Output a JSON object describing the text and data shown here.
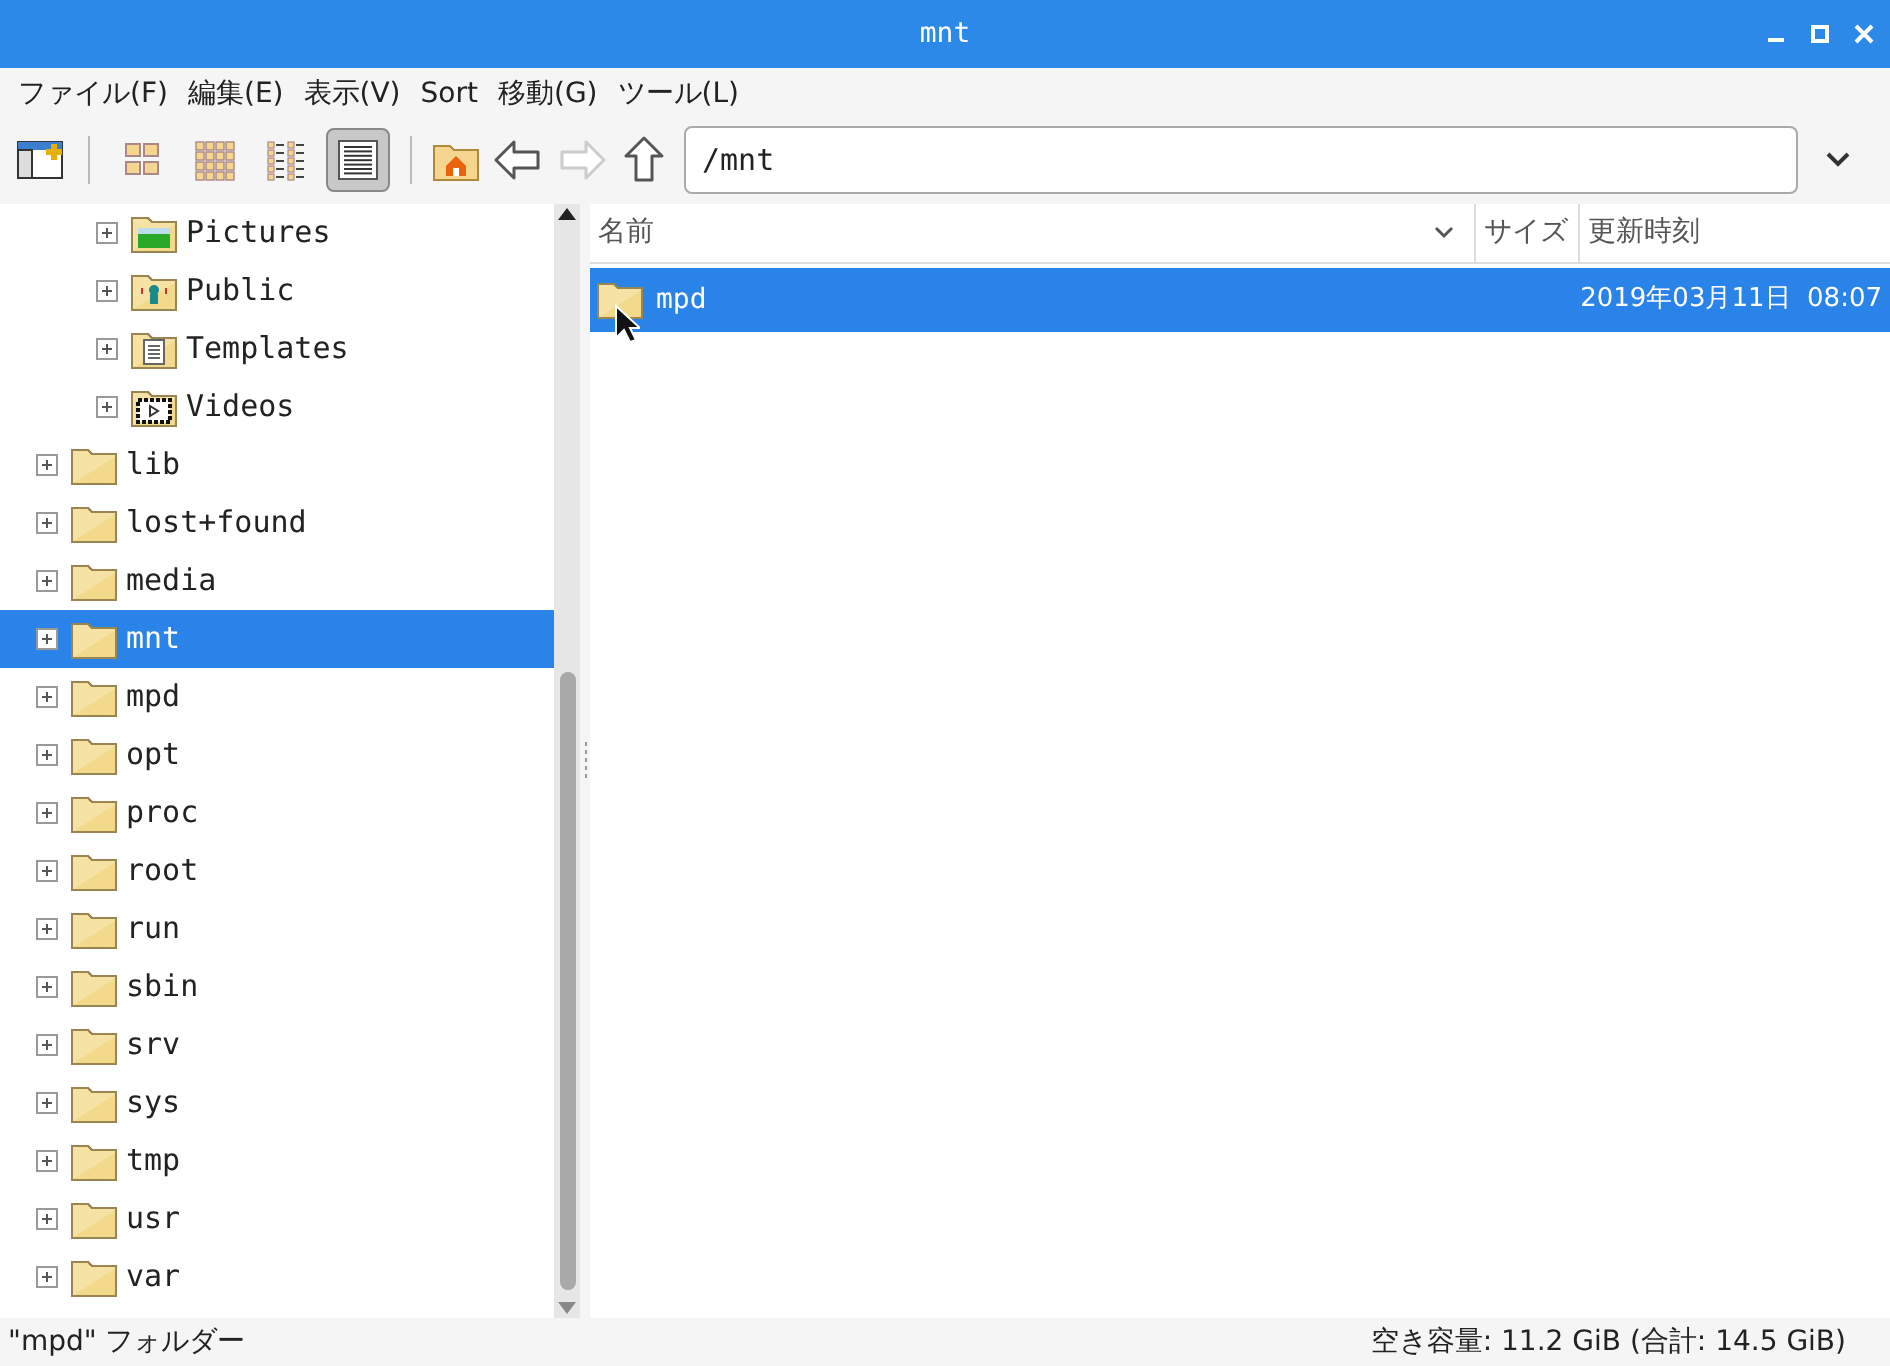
{
  "window": {
    "title": "mnt"
  },
  "menu": [
    "ファイル(F)",
    "編集(E)",
    "表示(V)",
    "Sort",
    "移動(G)",
    "ツール(L)"
  ],
  "toolbar": {
    "view_modes": [
      {
        "kind": "icons",
        "selected": false
      },
      {
        "kind": "thumbnails",
        "selected": false
      },
      {
        "kind": "compact",
        "selected": false
      },
      {
        "kind": "detailed",
        "selected": true
      }
    ],
    "forward_disabled": true,
    "path": "/mnt"
  },
  "tree": {
    "nested_items": [
      {
        "label": "Pictures",
        "kind": "pictures",
        "selected": false
      },
      {
        "label": "Public",
        "kind": "public",
        "selected": false
      },
      {
        "label": "Templates",
        "kind": "templates",
        "selected": false
      },
      {
        "label": "Videos",
        "kind": "videos",
        "selected": false
      }
    ],
    "items": [
      {
        "label": "lib",
        "selected": false
      },
      {
        "label": "lost+found",
        "selected": false
      },
      {
        "label": "media",
        "selected": false
      },
      {
        "label": "mnt",
        "selected": true
      },
      {
        "label": "mpd",
        "selected": false
      },
      {
        "label": "opt",
        "selected": false
      },
      {
        "label": "proc",
        "selected": false
      },
      {
        "label": "root",
        "selected": false
      },
      {
        "label": "run",
        "selected": false
      },
      {
        "label": "sbin",
        "selected": false
      },
      {
        "label": "srv",
        "selected": false
      },
      {
        "label": "sys",
        "selected": false
      },
      {
        "label": "tmp",
        "selected": false
      },
      {
        "label": "usr",
        "selected": false
      },
      {
        "label": "var",
        "selected": false
      }
    ]
  },
  "file_list": {
    "columns": [
      "名前",
      "サイズ",
      "更新時刻"
    ],
    "rows": [
      {
        "name": "mpd",
        "size": "",
        "modified": "2019年03月11日  08:07",
        "selected": true
      }
    ]
  },
  "status_bar": {
    "left": "\"mpd\" フォルダー",
    "right": "空き容量: 11.2 GiB (合計: 14.5 GiB)"
  }
}
